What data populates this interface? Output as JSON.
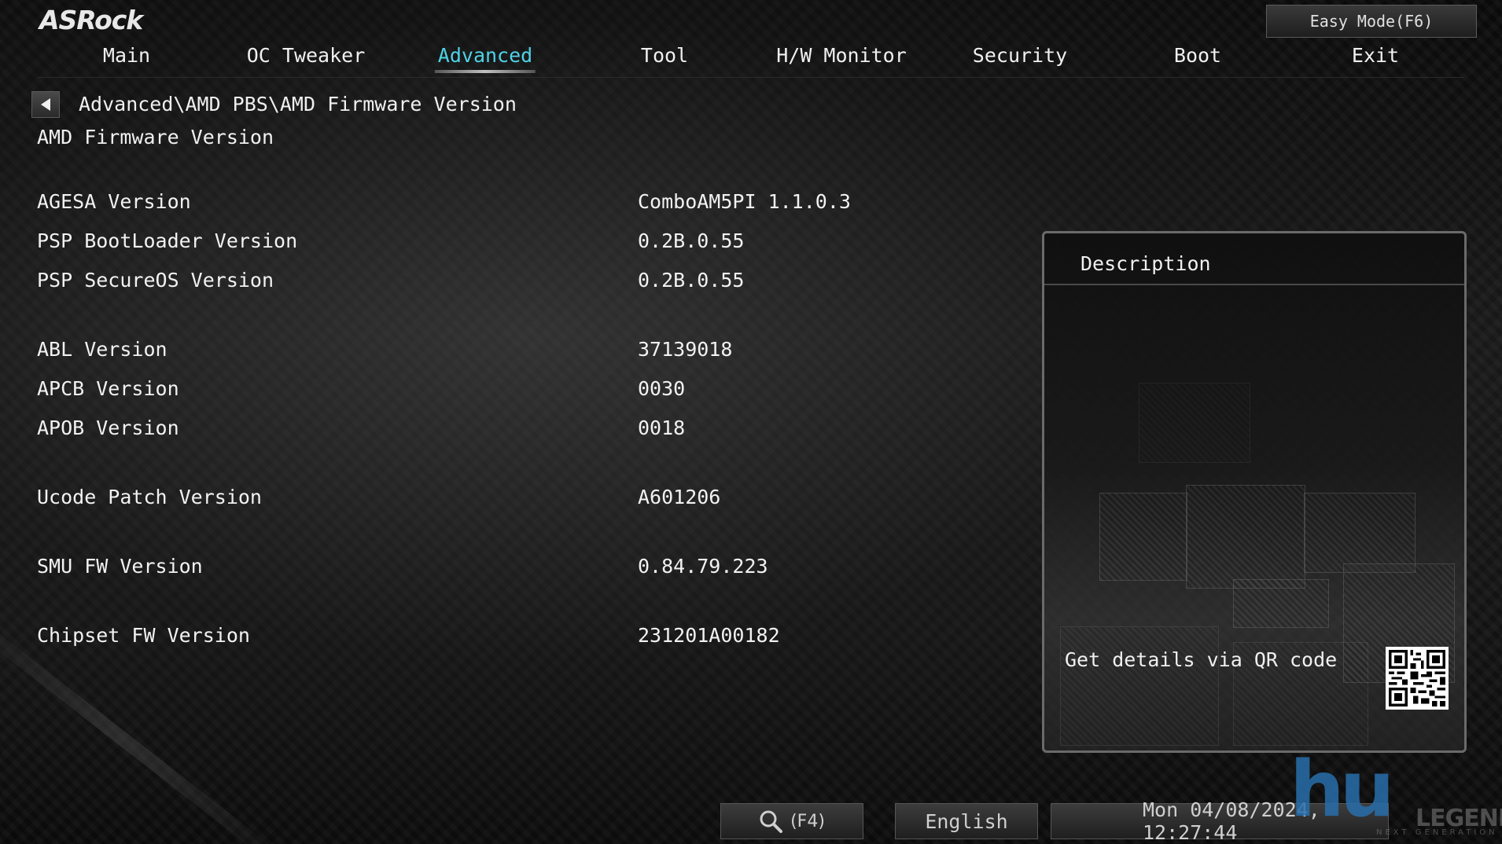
{
  "brand": {
    "logo": "ASRock"
  },
  "header": {
    "easy_mode_label": "Easy Mode(F6)"
  },
  "tabs": [
    {
      "label": "Main"
    },
    {
      "label": "OC Tweaker"
    },
    {
      "label": "Advanced",
      "active": true
    },
    {
      "label": "Tool"
    },
    {
      "label": "H/W Monitor"
    },
    {
      "label": "Security"
    },
    {
      "label": "Boot"
    },
    {
      "label": "Exit"
    }
  ],
  "breadcrumb": "Advanced\\AMD PBS\\AMD Firmware Version",
  "page_title": "AMD Firmware Version",
  "rows": [
    {
      "label": "AGESA Version",
      "value": "ComboAM5PI 1.1.0.3"
    },
    {
      "label": "PSP BootLoader Version",
      "value": "0.2B.0.55"
    },
    {
      "label": "PSP SecureOS Version",
      "value": "0.2B.0.55"
    },
    {
      "label": "ABL Version",
      "value": "37139018"
    },
    {
      "label": "APCB Version",
      "value": "0030"
    },
    {
      "label": "APOB Version",
      "value": "0018"
    },
    {
      "label": "Ucode Patch Version",
      "value": "A601206"
    },
    {
      "label": "SMU FW Version",
      "value": "0.84.79.223"
    },
    {
      "label": "Chipset FW Version",
      "value": "231201A00182"
    }
  ],
  "description": {
    "title": "Description",
    "qr_caption": "Get details via QR code"
  },
  "footer": {
    "search_key": "(F4)",
    "language": "English",
    "datetime": "Mon 04/08/2024, 12:27:44"
  },
  "watermark": {
    "mark": "hu",
    "text": "LEGEND",
    "subtext": "NEXT GENERATION"
  },
  "colors": {
    "active_tab": "#4fd2e6",
    "text": "#f0f0f0",
    "background": "#141414"
  },
  "icons": {
    "back": "left-triangle-icon",
    "search": "magnifier-icon",
    "qr": "qr-code-icon"
  }
}
